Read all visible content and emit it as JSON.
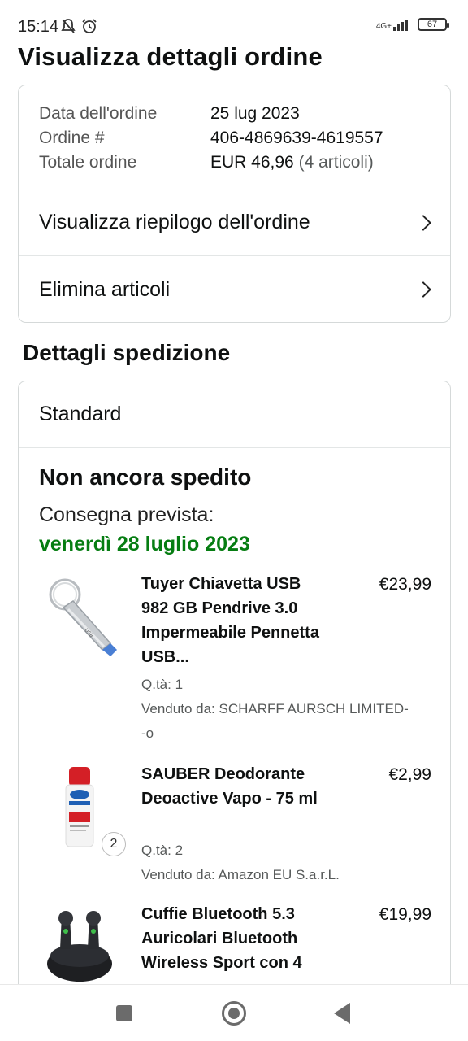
{
  "status_bar": {
    "time": "15:14",
    "network": "4G+",
    "battery": "67"
  },
  "page": {
    "title": "Visualizza dettagli ordine"
  },
  "order": {
    "date_label": "Data dell'ordine",
    "date_value": "25 lug 2023",
    "number_label": "Ordine #",
    "number_value": "406-4869639-4619557",
    "total_label": "Totale ordine",
    "total_value": "EUR 46,96",
    "total_items": "(4 articoli)"
  },
  "links": {
    "summary": "Visualizza riepilogo dell'ordine",
    "remove": "Elimina articoli"
  },
  "shipment": {
    "section_title": "Dettagli spedizione",
    "method": "Standard",
    "status": "Non ancora spedito",
    "delivery_label": "Consegna prevista:",
    "delivery_date": "venerdì 28 luglio 2023",
    "delivery_color": "#067d12"
  },
  "items": [
    {
      "title": "Tuyer Chiavetta USB 982 GB Pendrive 3.0 Impermeabile Pennetta USB...",
      "price": "€23,99",
      "qty": "Q.tà: 1",
      "seller": "Venduto da: SCHARFF AURSCH LIMITED-\n-o"
    },
    {
      "title": "SAUBER Deodorante Deoactive Vapo - 75 ml",
      "price": "€2,99",
      "qty": "Q.tà: 2",
      "qty_badge": "2",
      "seller": "Venduto da: Amazon EU S.a.r.L."
    },
    {
      "title": "Cuffie Bluetooth 5.3 Auricolari Bluetooth Wireless Sport con 4",
      "price": "€19,99"
    }
  ],
  "icons": {
    "status": [
      "mute-icon",
      "alarm-icon",
      "signal-icon",
      "battery-icon"
    ],
    "nav": [
      "recent-apps-icon",
      "home-icon",
      "back-icon"
    ]
  }
}
